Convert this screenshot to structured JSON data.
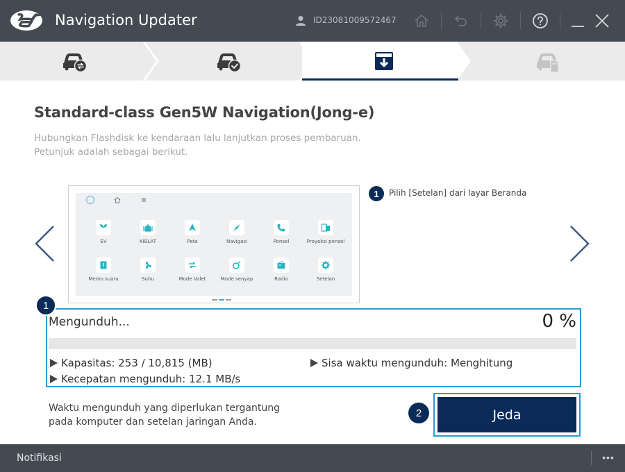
{
  "window": {
    "title": "Navigation Updater",
    "user_id": "ID23081009572467",
    "icons": [
      "hyundai-logo",
      "user-icon",
      "home-icon",
      "undo-icon",
      "gear-icon",
      "help-icon",
      "minimize-icon",
      "close-icon"
    ]
  },
  "steps": [
    {
      "icon": "car-sync-icon",
      "state": "done"
    },
    {
      "icon": "car-check-icon",
      "state": "done"
    },
    {
      "icon": "download-box-icon",
      "state": "active"
    },
    {
      "icon": "car-sd-icon",
      "state": "pending"
    }
  ],
  "main": {
    "title": "Standard-class Gen5W Navigation(Jong-e)",
    "desc_line1": "Hubungkan Flashdisk ke kendaraan lalu lanjutkan proses pembaruan.",
    "desc_line2": "Petunjuk adalah sebagai berikut.",
    "hint_number": "1",
    "hint_text": "Pilih [Setelan] dari layar Beranda"
  },
  "preview": {
    "apps": [
      {
        "label": "EV"
      },
      {
        "label": "KIBLAT"
      },
      {
        "label": "Peta"
      },
      {
        "label": "Navigasi"
      },
      {
        "label": "Ponsel"
      },
      {
        "label": "Proyeksi ponsel"
      },
      {
        "label": "Memo suara"
      },
      {
        "label": "Suhu"
      },
      {
        "label": "Mode Valet"
      },
      {
        "label": "Mode senyap"
      },
      {
        "label": "Radio"
      },
      {
        "label": "Setelan"
      }
    ]
  },
  "download": {
    "badge": "1",
    "status": "Mengunduh...",
    "percent_text": "0 %",
    "progress": 0,
    "capacity": "Kapasitas: 253 / 10,815 (MB)",
    "remaining": "Sisa waktu mengunduh: Menghitung",
    "speed": "Kecepatan mengunduh: 12.1 MB/s"
  },
  "footer": {
    "note_line1": "Waktu mengunduh yang diperlukan tergantung",
    "note_line2": "pada komputer dan setelan jaringan Anda.",
    "pause_label": "Jeda",
    "pause_badge": "2"
  },
  "bottombar": {
    "notification_label": "Notifikasi",
    "more_label": "•••"
  },
  "colors": {
    "titlebar": "#444a52",
    "accent": "#2a9ad2",
    "primary": "#0a2b57"
  }
}
